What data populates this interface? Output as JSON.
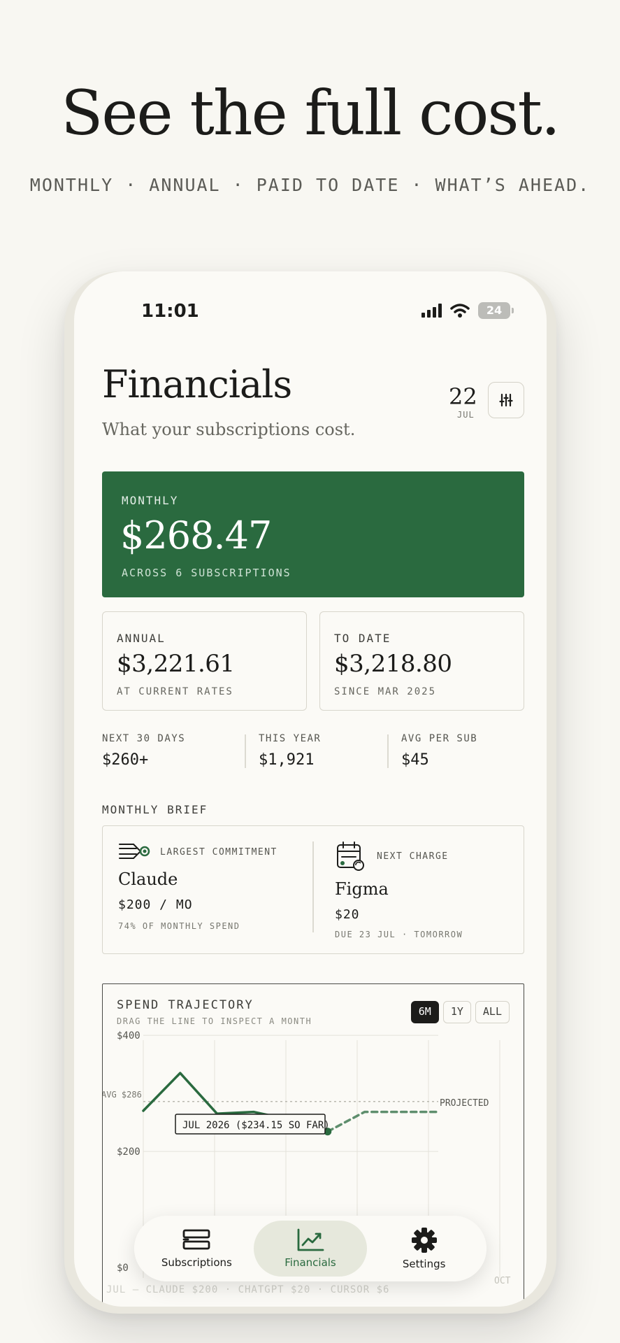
{
  "hero": {
    "title": "See the full cost.",
    "subtitle": "MONTHLY · ANNUAL · PAID TO DATE · WHAT’S AHEAD."
  },
  "status_bar": {
    "time": "11:01",
    "battery": "24"
  },
  "header": {
    "title": "Financials",
    "subtitle": "What your subscriptions cost.",
    "date_day": "22",
    "date_month": "JUL",
    "filter_icon": "sliders-icon"
  },
  "monthly_card": {
    "label": "MONTHLY",
    "amount": "$268.47",
    "caption": "ACROSS 6 SUBSCRIPTIONS",
    "color": "#2a6a3f"
  },
  "annual_card": {
    "label": "ANNUAL",
    "amount": "$3,221.61",
    "caption": "AT CURRENT RATES"
  },
  "to_date_card": {
    "label": "TO DATE",
    "amount": "$3,218.80",
    "caption": "SINCE MAR 2025"
  },
  "stats": [
    {
      "label": "NEXT 30 DAYS",
      "value": "$260+"
    },
    {
      "label": "THIS YEAR",
      "value": "$1,921"
    },
    {
      "label": "AVG PER SUB",
      "value": "$45"
    }
  ],
  "brief": {
    "section_label": "MONTHLY BRIEF",
    "largest": {
      "kicker": "LARGEST COMMITMENT",
      "name": "Claude",
      "price": "$200 / MO",
      "note": "74% OF MONTHLY SPEND",
      "icon": "claude-logo-icon"
    },
    "next": {
      "kicker": "NEXT CHARGE",
      "name": "Figma",
      "price": "$20",
      "note": "DUE 23 JUL · TOMORROW",
      "icon": "calendar-refresh-icon"
    }
  },
  "chart": {
    "title": "SPEND TRAJECTORY",
    "hint": "DRAG THE LINE TO INSPECT A MONTH",
    "ranges": [
      "6M",
      "1Y",
      "ALL"
    ],
    "active_range": "6M",
    "tooltip": "JUL 2026 ($234.15 SO FAR)",
    "projected_label": "PROJECTED",
    "avg_label": "AVG $286",
    "last_axis_label": "OCT",
    "footer_text": "JUL — CLAUDE $200 · CHATGPT $20 · CURSOR $6"
  },
  "chart_data": {
    "type": "line",
    "title": "SPEND TRAJECTORY",
    "y_ticks": [
      0,
      200,
      400
    ],
    "y_tick_labels": [
      "$0",
      "$200",
      "$400"
    ],
    "ylim": [
      0,
      440
    ],
    "average": 286,
    "series": [
      {
        "name": "",
        "x": [
          0,
          1,
          2,
          3,
          4,
          5
        ],
        "values": [
          270,
          335,
          265,
          268,
          254,
          234.15
        ],
        "style": "solid"
      },
      {
        "name": "PROJECTED",
        "x": [
          5,
          6,
          7,
          8
        ],
        "values": [
          234.15,
          268,
          268,
          268
        ],
        "style": "dashed"
      }
    ],
    "grid": true,
    "accent": "#2a6a3f"
  },
  "tabbar": {
    "items": [
      {
        "label": "Subscriptions",
        "icon": "subscriptions-stack-icon"
      },
      {
        "label": "Financials",
        "icon": "chart-trend-icon"
      },
      {
        "label": "Settings",
        "icon": "gear-icon"
      }
    ],
    "active": "Financials"
  }
}
